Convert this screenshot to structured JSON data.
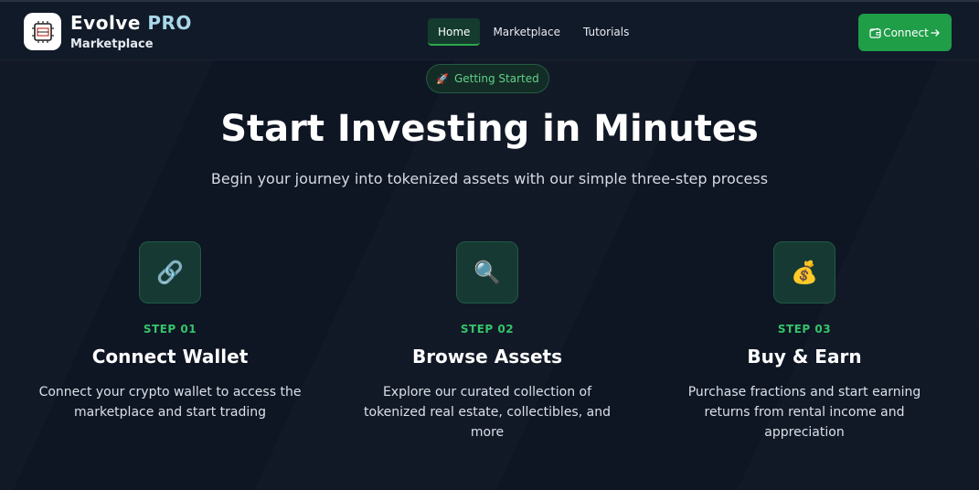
{
  "header": {
    "brand_part1": "Evolve",
    "brand_part2": "PRO",
    "brand_sub": "Marketplace",
    "logo_icon": "chip-icon",
    "nav": [
      {
        "label": "Home",
        "active": true
      },
      {
        "label": "Marketplace",
        "active": false
      },
      {
        "label": "Tutorials",
        "active": false
      }
    ],
    "connect_label": "Connect",
    "connect_icon": "wallet-icon",
    "connect_arrow_icon": "arrow-right-icon"
  },
  "hero": {
    "badge_icon": "🚀",
    "badge_label": "Getting Started",
    "title": "Start Investing in Minutes",
    "subtitle": "Begin your journey into tokenized assets with our simple three-step process"
  },
  "steps": [
    {
      "icon": "🔗",
      "icon_name": "link-icon",
      "label": "STEP 01",
      "title": "Connect Wallet",
      "description": "Connect your crypto wallet to access the marketplace and start trading"
    },
    {
      "icon": "🔍",
      "icon_name": "magnifier-icon",
      "label": "STEP 02",
      "title": "Browse Assets",
      "description": "Explore our curated collection of tokenized real estate, collectibles, and more"
    },
    {
      "icon": "💰",
      "icon_name": "money-bag-icon",
      "label": "STEP 03",
      "title": "Buy & Earn",
      "description": "Purchase fractions and start earning returns from rental income and appreciation"
    }
  ],
  "colors": {
    "background": "#0f1624",
    "accent_green": "#1f9d47",
    "step_label_green": "#35c46a",
    "brand_pro": "#a8d7e8"
  }
}
